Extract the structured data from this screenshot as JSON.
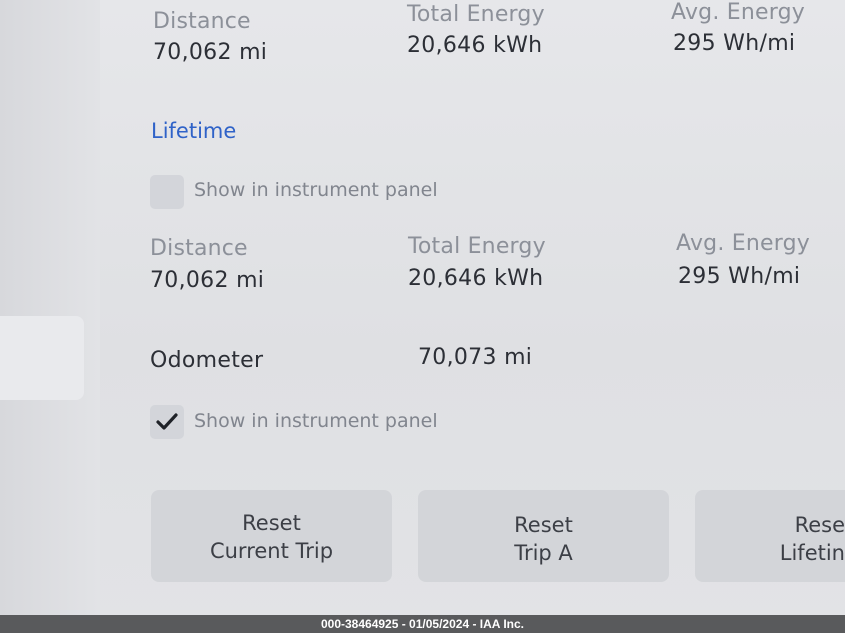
{
  "trip_stats": {
    "distance_label": "Distance",
    "distance_value": "70,062 mi",
    "energy_label": "Total Energy",
    "energy_value": "20,646 kWh",
    "avg_label": "Avg. Energy",
    "avg_value": "295 Wh/mi"
  },
  "lifetime": {
    "title": "Lifetime",
    "show_panel_label": "Show in instrument panel",
    "show_panel_checked": false,
    "distance_label": "Distance",
    "distance_value": "70,062 mi",
    "energy_label": "Total Energy",
    "energy_value": "20,646 kWh",
    "avg_label": "Avg. Energy",
    "avg_value": "295 Wh/mi"
  },
  "odometer": {
    "label": "Odometer",
    "value": "70,073 mi",
    "show_panel_label": "Show in instrument panel",
    "show_panel_checked": true
  },
  "buttons": [
    {
      "line1": "Reset",
      "line2": "Current Trip"
    },
    {
      "line1": "Reset",
      "line2": "Trip A"
    },
    {
      "line1": "Rese",
      "line2": "Lifetin"
    }
  ],
  "footer_text": "000-38464925 - 01/05/2024 - IAA Inc."
}
